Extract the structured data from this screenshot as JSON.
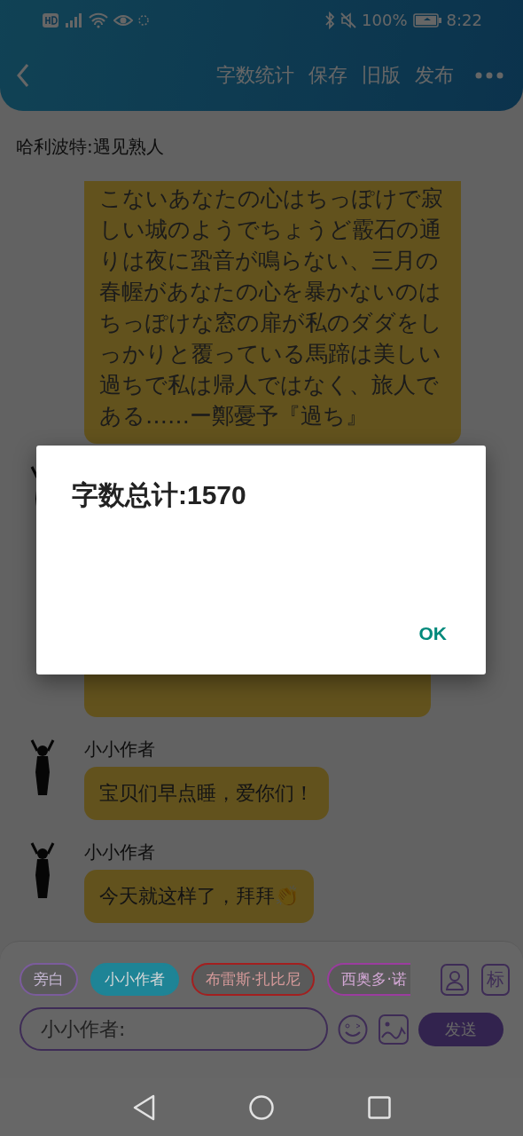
{
  "status_bar": {
    "battery": "100%",
    "time": "8:22"
  },
  "toolbar": {
    "actions": [
      "字数统计",
      "保存",
      "旧版",
      "发布"
    ]
  },
  "document_title": "哈利波特:遇见熟人",
  "messages": [
    {
      "kind": "continued",
      "text": "こないあなたの心はちっぽけで寂しい城のようでちょうど霰石の通りは夜に蛩音が鳴らない、三月の春幄があなたの心を暴かないのはちっぽけな窓の扉が私のダダをしっかりと覆っている馬蹄は美しい過ちで私は帰人ではなく、旅人である……ー鄭憂予『過ち』"
    },
    {
      "kind": "covered"
    },
    {
      "kind": "text",
      "name": "小小作者",
      "text": "宝贝们早点睡，爱你们！"
    },
    {
      "kind": "text",
      "name": "小小作者",
      "text": "今天就这样了，拜拜👏"
    }
  ],
  "composer": {
    "chips": [
      {
        "label": "旁白",
        "color": "#7b5c9c",
        "selected": false
      },
      {
        "label": "小小作者",
        "color": "#1e8496",
        "selected": true
      },
      {
        "label": "布雷斯·扎比尼",
        "color": "#a31f1f",
        "selected": false
      },
      {
        "label": "西奥多·诺",
        "color": "#9b3c9f",
        "selected": false
      }
    ],
    "tag_button": "标",
    "input": {
      "placeholder": "小小作者:"
    },
    "send_button": "发送"
  },
  "dialog": {
    "message": "字数总计:1570",
    "button": "OK"
  }
}
